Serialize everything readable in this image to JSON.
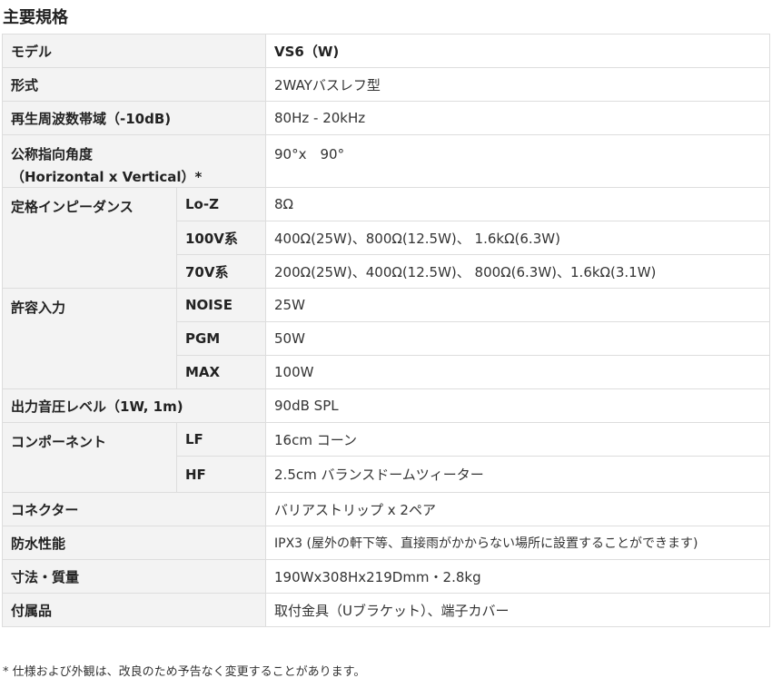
{
  "heading": "主要規格",
  "rows": [
    {
      "label": "モデル",
      "value": "VS6（W)"
    },
    {
      "label": "形式",
      "value": "2WAYバスレフ型"
    },
    {
      "label": "再生周波数帯域（-10dB)",
      "value": "80Hz - 20kHz"
    },
    {
      "label_line1": "公称指向角度",
      "label_line2": "（Horizontal x Vertical）*",
      "value": "90°x　90°"
    },
    {
      "label": "定格インピーダンス",
      "subs": [
        {
          "sub": "Lo-Z",
          "value": "8Ω"
        },
        {
          "sub": "100V系",
          "value": "400Ω(25W)、800Ω(12.5W)、 1.6kΩ(6.3W)"
        },
        {
          "sub": "70V系",
          "value": "200Ω(25W)、400Ω(12.5W)、 800Ω(6.3W)、1.6kΩ(3.1W)"
        }
      ]
    },
    {
      "label": "許容入力",
      "subs": [
        {
          "sub": "NOISE",
          "value": "25W"
        },
        {
          "sub": "PGM",
          "value": "50W"
        },
        {
          "sub": "MAX",
          "value": "100W"
        }
      ]
    },
    {
      "label": "出力音圧レベル（1W, 1m)",
      "value": "90dB SPL"
    },
    {
      "label": "コンポーネント",
      "subs": [
        {
          "sub": "LF",
          "value": "16cm コーン"
        },
        {
          "sub": "HF",
          "value": "2.5cm バランスドームツィーター"
        }
      ]
    },
    {
      "label": "コネクター",
      "value": "バリアストリップ x 2ペア"
    },
    {
      "label": "防水性能",
      "value": "IPX3 (屋外の軒下等、直接雨がかからない場所に設置することができます)"
    },
    {
      "label": "寸法・質量",
      "value": "190Wx308Hx219Dmm・2.8kg"
    },
    {
      "label": "付属品",
      "value": "取付金具（Uブラケット）、端子カバー"
    }
  ],
  "footnote": "* 仕様および外観は、改良のため予告なく変更することがあります。"
}
